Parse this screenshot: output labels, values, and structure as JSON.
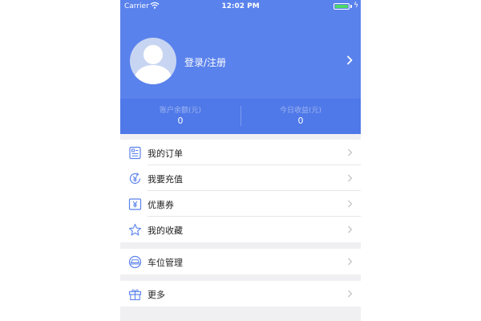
{
  "status_bar": {
    "carrier": "Carrier",
    "time": "12:02 PM"
  },
  "profile": {
    "login_label": "登录/注册"
  },
  "stats": [
    {
      "label": "账户余额(元)",
      "value": "0"
    },
    {
      "label": "今日收益(元)",
      "value": "0"
    }
  ],
  "menu": {
    "group1": [
      {
        "label": "我的订单",
        "icon": "order-icon"
      },
      {
        "label": "我要充值",
        "icon": "recharge-icon"
      },
      {
        "label": "优惠券",
        "icon": "coupon-icon"
      },
      {
        "label": "我的收藏",
        "icon": "star-icon"
      }
    ],
    "group2": [
      {
        "label": "车位管理",
        "icon": "parking-icon"
      }
    ],
    "group3": [
      {
        "label": "更多",
        "icon": "gift-icon"
      }
    ]
  },
  "colors": {
    "header": "#5a82ec",
    "stats_bar": "#4f78e8",
    "icon": "#5a82ec",
    "background": "#f0f0f3"
  }
}
